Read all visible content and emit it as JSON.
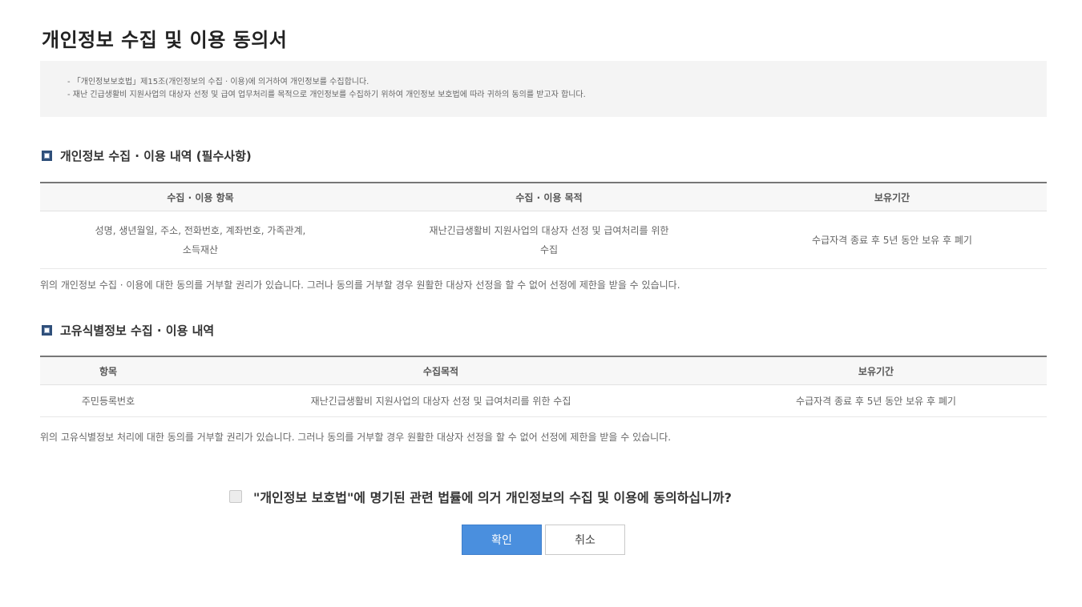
{
  "page": {
    "title": "개인정보 수집 및 이용 동의서"
  },
  "notice": {
    "lines": [
      "- 「개인정보보호법」제15조(개인정보의 수집 · 이용)에 의거하여 개인정보를 수집합니다.",
      "- 재난 긴급생활비 지원사업의 대상자 선정 및 급여 업무처리를 목적으로 개인정보를 수집하기 위하여 개인정보 보호법에 따라 귀하의 동의를 받고자 합니다."
    ]
  },
  "section1": {
    "title": "개인정보 수집 · 이용 내역 (필수사항)",
    "headers": [
      "수집 · 이용 항목",
      "수집 · 이용 목적",
      "보유기간"
    ],
    "row": {
      "items_line1": "성명, 생년월일, 주소, 전화번호, 계좌번호, 가족관계,",
      "items_line2": "소득재산",
      "purpose_line1": "재난긴급생활비 지원사업의 대상자 선정 및 급여처리를 위한",
      "purpose_line2": "수집",
      "period": "수급자격 종료 후 5년 동안 보유 후 폐기"
    },
    "note": "위의 개인정보 수집 · 이용에 대한 동의를 거부할 권리가 있습니다. 그러나 동의를 거부할 경우 원활한 대상자 선정을 할 수 없어 선정에 제한을 받을 수 있습니다."
  },
  "section2": {
    "title": "고유식별정보 수집 · 이용 내역",
    "headers": [
      "항목",
      "수집목적",
      "보유기간"
    ],
    "row": {
      "item": "주민등록번호",
      "purpose": "재난긴급생활비 지원사업의 대상자 선정 및 급여처리를 위한 수집",
      "period": "수급자격 종료 후 5년 동안 보유 후 폐기"
    },
    "note": "위의 고유식별정보 처리에 대한 동의를 거부할 권리가 있습니다. 그러나 동의를 거부할 경우 원활한 대상자 선정을 할 수 없어 선정에 제한을 받을 수 있습니다."
  },
  "agreement": {
    "question": "\"개인정보 보호법\"에 명기된 관련 법률에 의거 개인정보의 수집 및 이용에 동의하십니까?",
    "checked": false
  },
  "buttons": {
    "confirm": "확인",
    "cancel": "취소"
  },
  "colors": {
    "primary": "#4a8fde",
    "icon": "#2f4f7a"
  }
}
